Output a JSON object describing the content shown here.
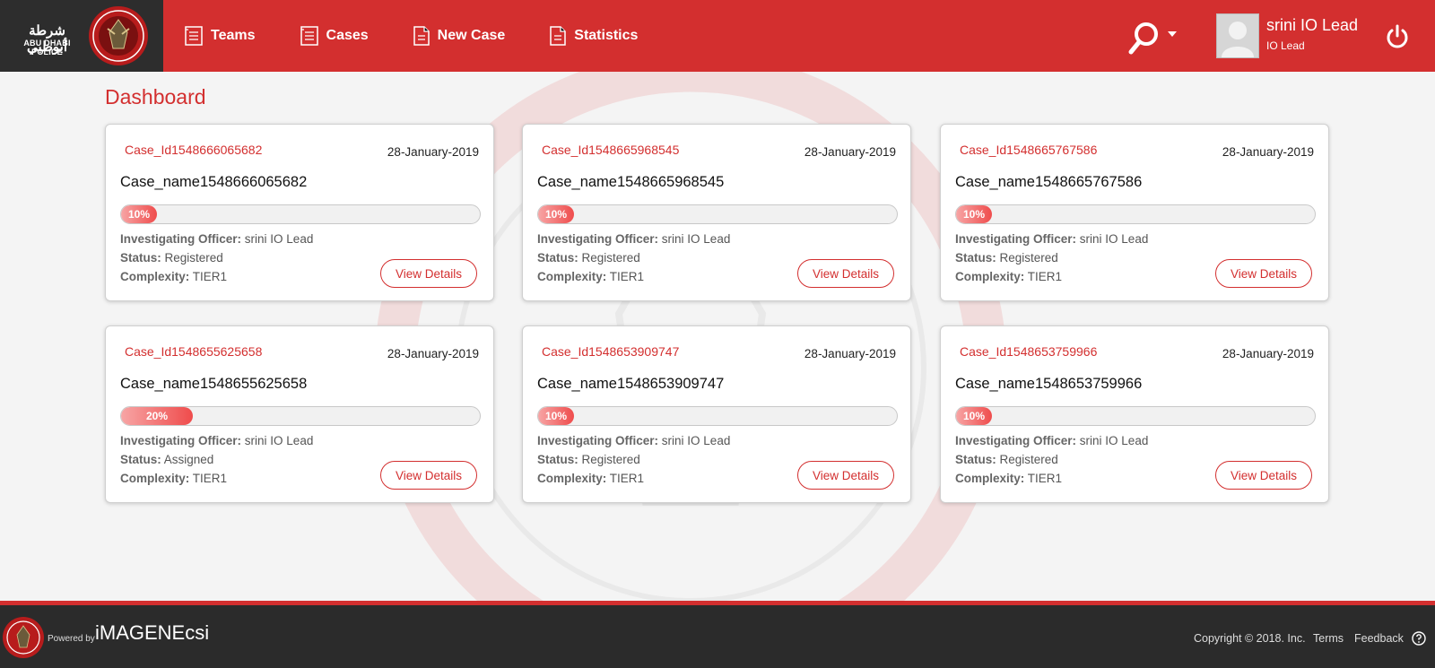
{
  "header": {
    "logo_arabic": "شرطة أبوظبي",
    "logo_english": "ABU DHABI POLICE",
    "nav": [
      {
        "label": "Teams"
      },
      {
        "label": "Cases"
      },
      {
        "label": "New Case"
      },
      {
        "label": "Statistics"
      }
    ],
    "user": {
      "name": "srini IO Lead",
      "role": "IO Lead"
    }
  },
  "page_title": "Dashboard",
  "field_labels": {
    "officer": "Investigating Officer:",
    "status": "Status:",
    "complexity": "Complexity:"
  },
  "view_details_label": "View Details",
  "cards": [
    {
      "id": "Case_Id1548666065682",
      "date": "28-January-2019",
      "name": "Case_name1548666065682",
      "progress": 10,
      "progress_label": "10%",
      "officer": "srini IO Lead",
      "status": "Registered",
      "complexity": "TIER1"
    },
    {
      "id": "Case_Id1548665968545",
      "date": "28-January-2019",
      "name": "Case_name1548665968545",
      "progress": 10,
      "progress_label": "10%",
      "officer": "srini IO Lead",
      "status": "Registered",
      "complexity": "TIER1"
    },
    {
      "id": "Case_Id1548665767586",
      "date": "28-January-2019",
      "name": "Case_name1548665767586",
      "progress": 10,
      "progress_label": "10%",
      "officer": "srini IO Lead",
      "status": "Registered",
      "complexity": "TIER1"
    },
    {
      "id": "Case_Id1548655625658",
      "date": "28-January-2019",
      "name": "Case_name1548655625658",
      "progress": 20,
      "progress_label": "20%",
      "officer": "srini IO Lead",
      "status": "Assigned",
      "complexity": "TIER1"
    },
    {
      "id": "Case_Id1548653909747",
      "date": "28-January-2019",
      "name": "Case_name1548653909747",
      "progress": 10,
      "progress_label": "10%",
      "officer": "srini IO Lead",
      "status": "Registered",
      "complexity": "TIER1"
    },
    {
      "id": "Case_Id1548653759966",
      "date": "28-January-2019",
      "name": "Case_name1548653759966",
      "progress": 10,
      "progress_label": "10%",
      "officer": "srini IO Lead",
      "status": "Registered",
      "complexity": "TIER1"
    }
  ],
  "footer": {
    "powered_by": "Powered by",
    "brand": "iMAGENEcsi",
    "copyright": "Copyright © 2018. Inc.",
    "links": [
      {
        "label": "Terms"
      },
      {
        "label": "Feedback"
      }
    ]
  },
  "icons": {
    "nav": "document-icon",
    "search": "search-icon",
    "power": "power-icon",
    "help": "help-icon"
  },
  "colors": {
    "brand_red": "#d32f2f",
    "dark": "#2b2b2b"
  }
}
